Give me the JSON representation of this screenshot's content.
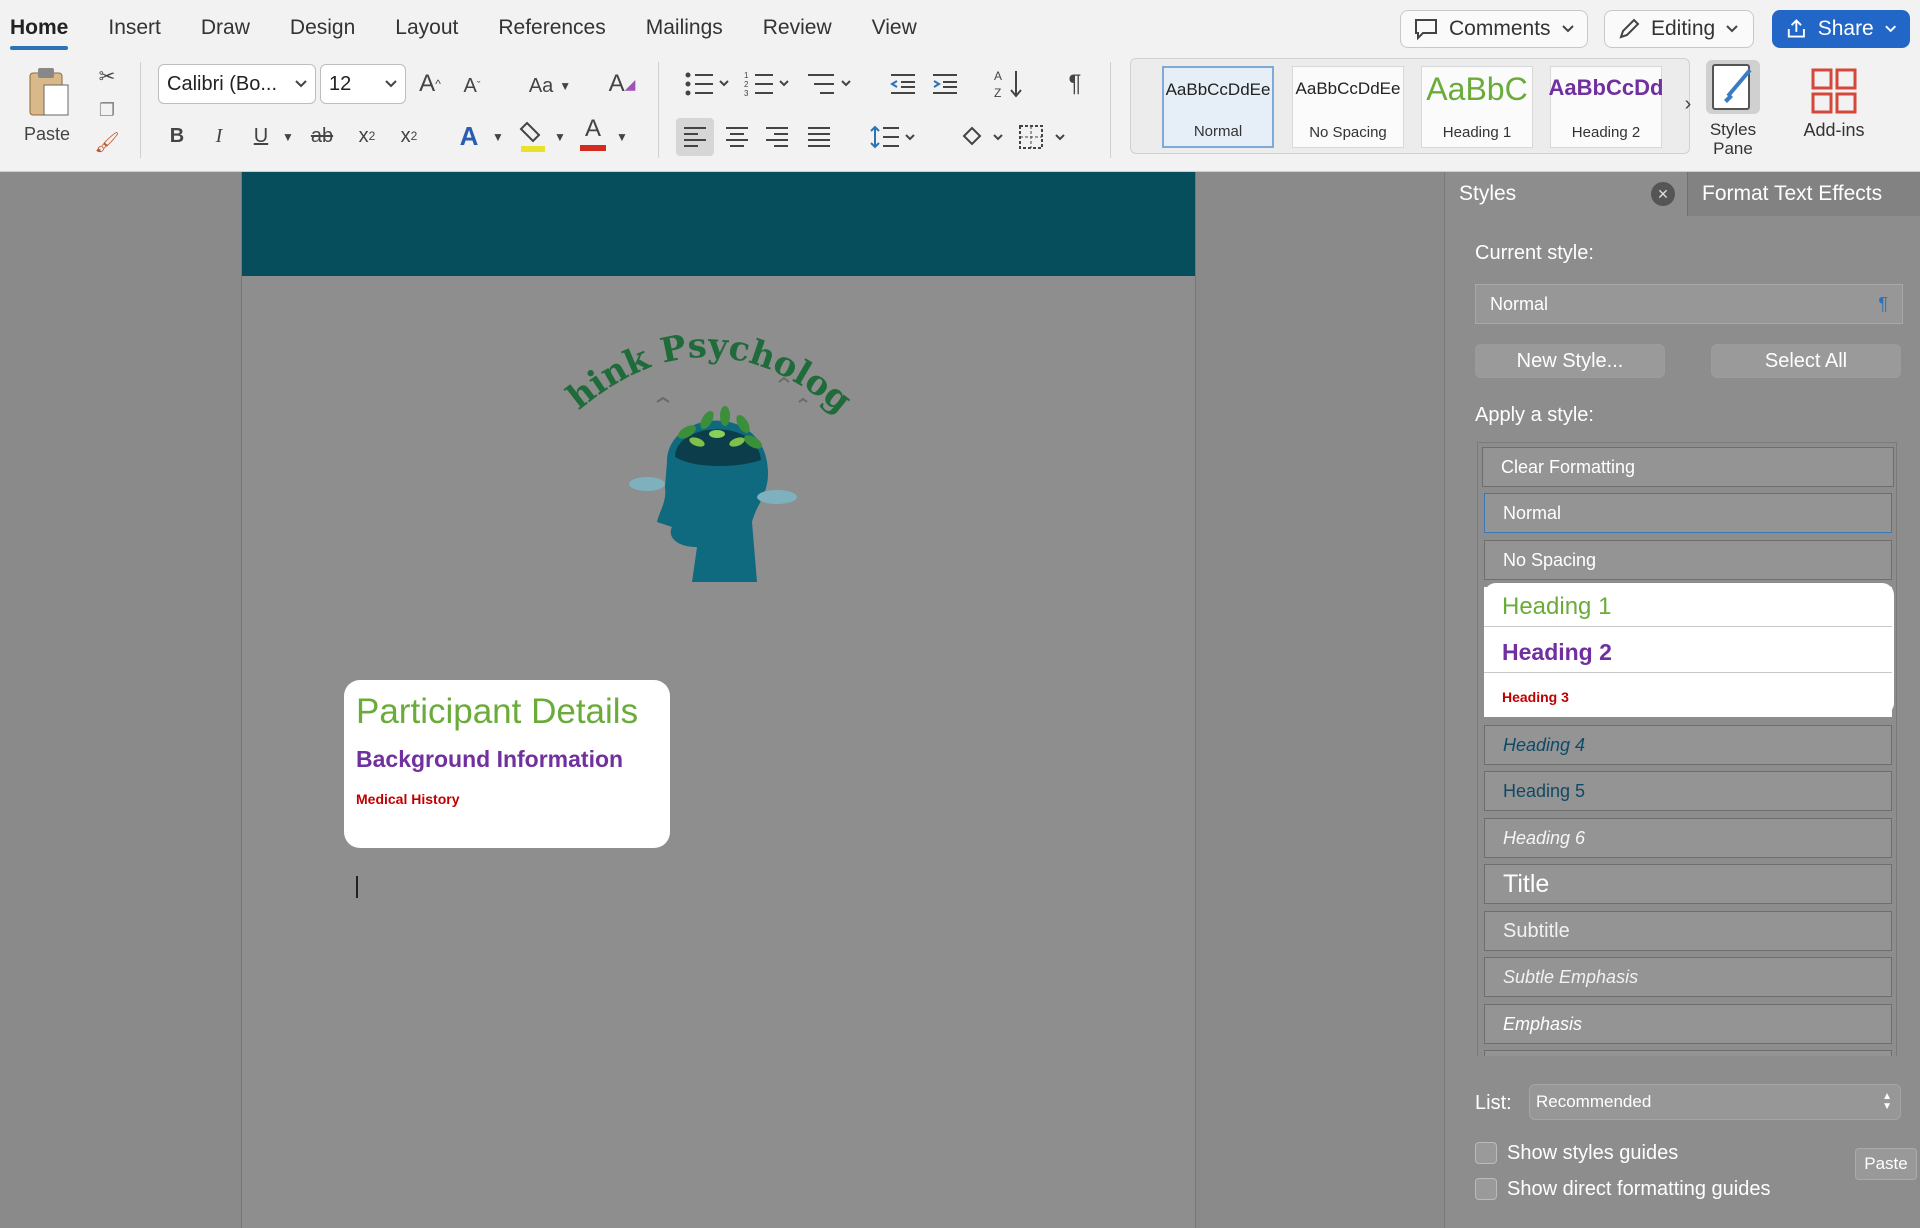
{
  "ribbon": {
    "tabs": [
      "Home",
      "Insert",
      "Draw",
      "Design",
      "Layout",
      "References",
      "Mailings",
      "Review",
      "View"
    ],
    "comments_label": "Comments",
    "editing_label": "Editing",
    "share_label": "Share",
    "paste_label": "Paste",
    "font_name": "Calibri (Bo...",
    "font_size": "12",
    "change_case_label": "Aa",
    "style_gallery": [
      {
        "preview": "AaBbCcDdEe",
        "name": "Normal"
      },
      {
        "preview": "AaBbCcDdEe",
        "name": "No Spacing"
      },
      {
        "preview": "AaBbC",
        "name": "Heading 1"
      },
      {
        "preview": "AaBbCcDd",
        "name": "Heading 2"
      }
    ],
    "styles_pane_label": "Styles Pane",
    "addins_label": "Add-ins"
  },
  "document": {
    "logo_text": "Think Psychology",
    "heading1": "Participant Details",
    "heading2": "Background Information",
    "heading3": "Medical History"
  },
  "styles_pane": {
    "tab_styles": "Styles",
    "tab_effects": "Format Text Effects",
    "current_style_label": "Current style:",
    "current_style_value": "Normal",
    "new_style_button": "New Style...",
    "select_all_button": "Select All",
    "apply_label": "Apply a style:",
    "styles": [
      "Clear Formatting",
      "Normal",
      "No Spacing",
      "Heading 1",
      "Heading 2",
      "Heading 3",
      "Heading 4",
      "Heading 5",
      "Heading 6",
      "Title",
      "Subtitle",
      "Subtle Emphasis",
      "Emphasis"
    ],
    "list_label": "List:",
    "list_value": "Recommended",
    "show_styles_guides": "Show styles guides",
    "show_direct_guides": "Show direct formatting guides",
    "paste_tooltip": "Paste"
  },
  "colors": {
    "accent": "#2b73b7",
    "heading1": "#6aab3a",
    "heading2": "#7030a0",
    "heading3": "#c00000",
    "banner": "#064e5c",
    "logo_green": "#1f6b3a",
    "head_teal": "#0f6a80"
  }
}
